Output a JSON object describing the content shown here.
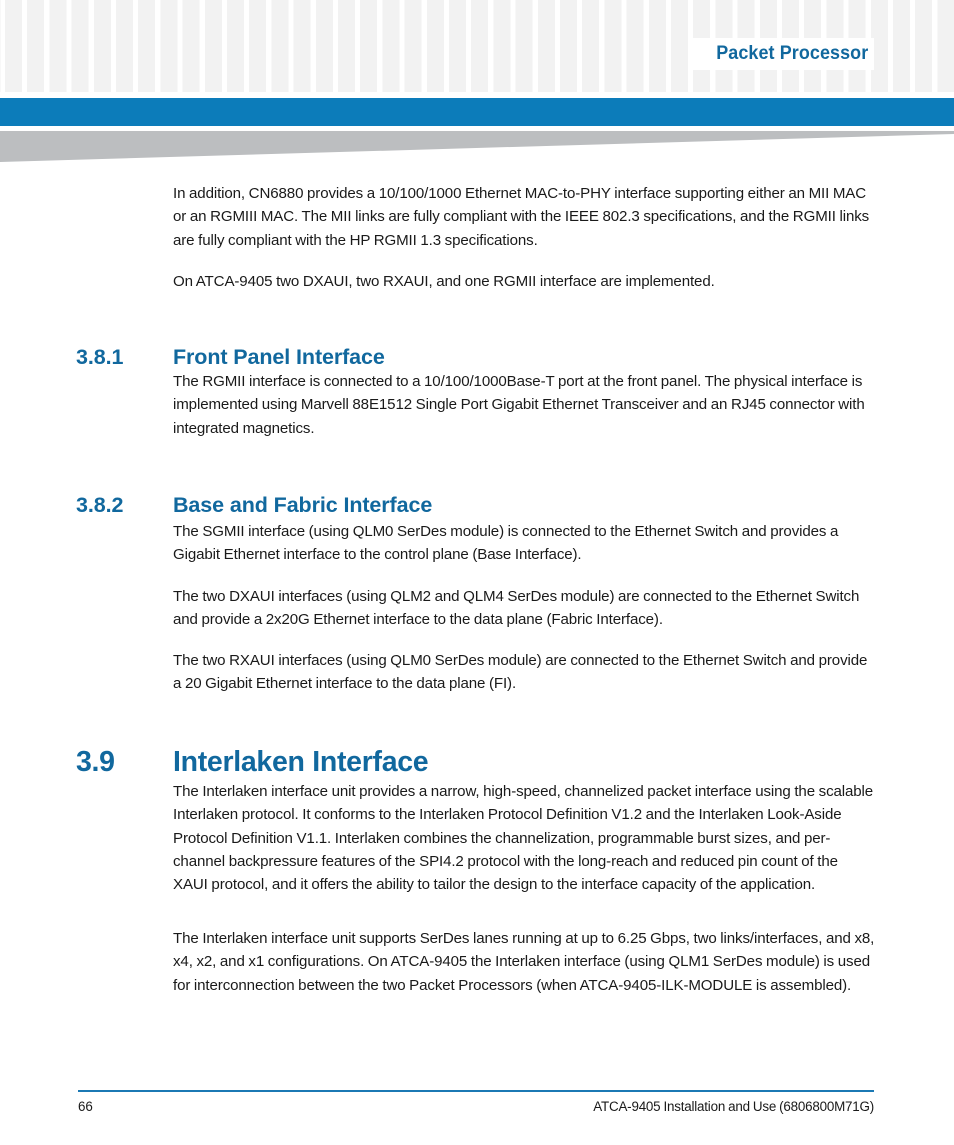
{
  "header": {
    "title": "Packet Processor",
    "accent_color": "#0c7cba",
    "heading_color": "#11689e",
    "wedge_color": "#bcbec0",
    "checker_color": "#f2f2f2"
  },
  "content": {
    "paragraphs": {
      "intro_1": "In addition, CN6880 provides a 10/100/1000 Ethernet MAC-to-PHY interface supporting either an MII MAC or an RGMIII MAC. The MII links are fully compliant with the IEEE 802.3 specifications, and the RGMII links are fully compliant with the HP RGMII 1.3 specifications.",
      "intro_2": "On ATCA-9405 two DXAUI, two RXAUI, and one RGMII interface are implemented.",
      "front_panel_1": "The RGMII interface is connected to a 10/100/1000Base-T port at the front panel. The physical interface is implemented using Marvell 88E1512 Single Port Gigabit Ethernet Transceiver and an RJ45 connector with integrated magnetics.",
      "base_fabric_1": "The SGMII interface (using QLM0 SerDes module) is connected to the Ethernet Switch and provides a Gigabit Ethernet interface to the control plane (Base Interface).",
      "base_fabric_2": "The two DXAUI interfaces (using QLM2 and QLM4 SerDes module) are connected to the Ethernet Switch and provide a 2x20G Ethernet interface to the data plane (Fabric Interface).",
      "base_fabric_3": "The two RXAUI interfaces (using QLM0 SerDes module) are connected to the Ethernet Switch and provide a 20 Gigabit Ethernet interface to the data plane (FI).",
      "interlaken_1": "The Interlaken interface unit provides a narrow, high-speed, channelized packet interface using the scalable Interlaken protocol. It conforms to the Interlaken Protocol Definition V1.2 and the Interlaken Look-Aside Protocol Definition V1.1. Interlaken combines the channelization, programmable burst sizes, and per-channel backpressure features of the SPI4.2 protocol with the long-reach and reduced pin count of the XAUI protocol, and it offers the ability to tailor the design to the interface capacity of the application.",
      "interlaken_2": "The Interlaken interface unit supports SerDes lanes running at up to 6.25 Gbps, two links/interfaces, and x8, x4, x2, and x1 configurations. On ATCA-9405 the Interlaken interface (using QLM1 SerDes module) is used for interconnection between the two Packet Processors (when ATCA-9405-ILK-MODULE is assembled)."
    },
    "headings": {
      "front_panel": {
        "number": "3.8.1",
        "title": "Front Panel Interface"
      },
      "base_fabric": {
        "number": "3.8.2",
        "title": "Base and Fabric Interface"
      },
      "interlaken": {
        "number": "3.9",
        "title": "Interlaken Interface"
      }
    }
  },
  "footer": {
    "page_number": "66",
    "document_title": "ATCA-9405 Installation and Use (6806800M71G)"
  }
}
